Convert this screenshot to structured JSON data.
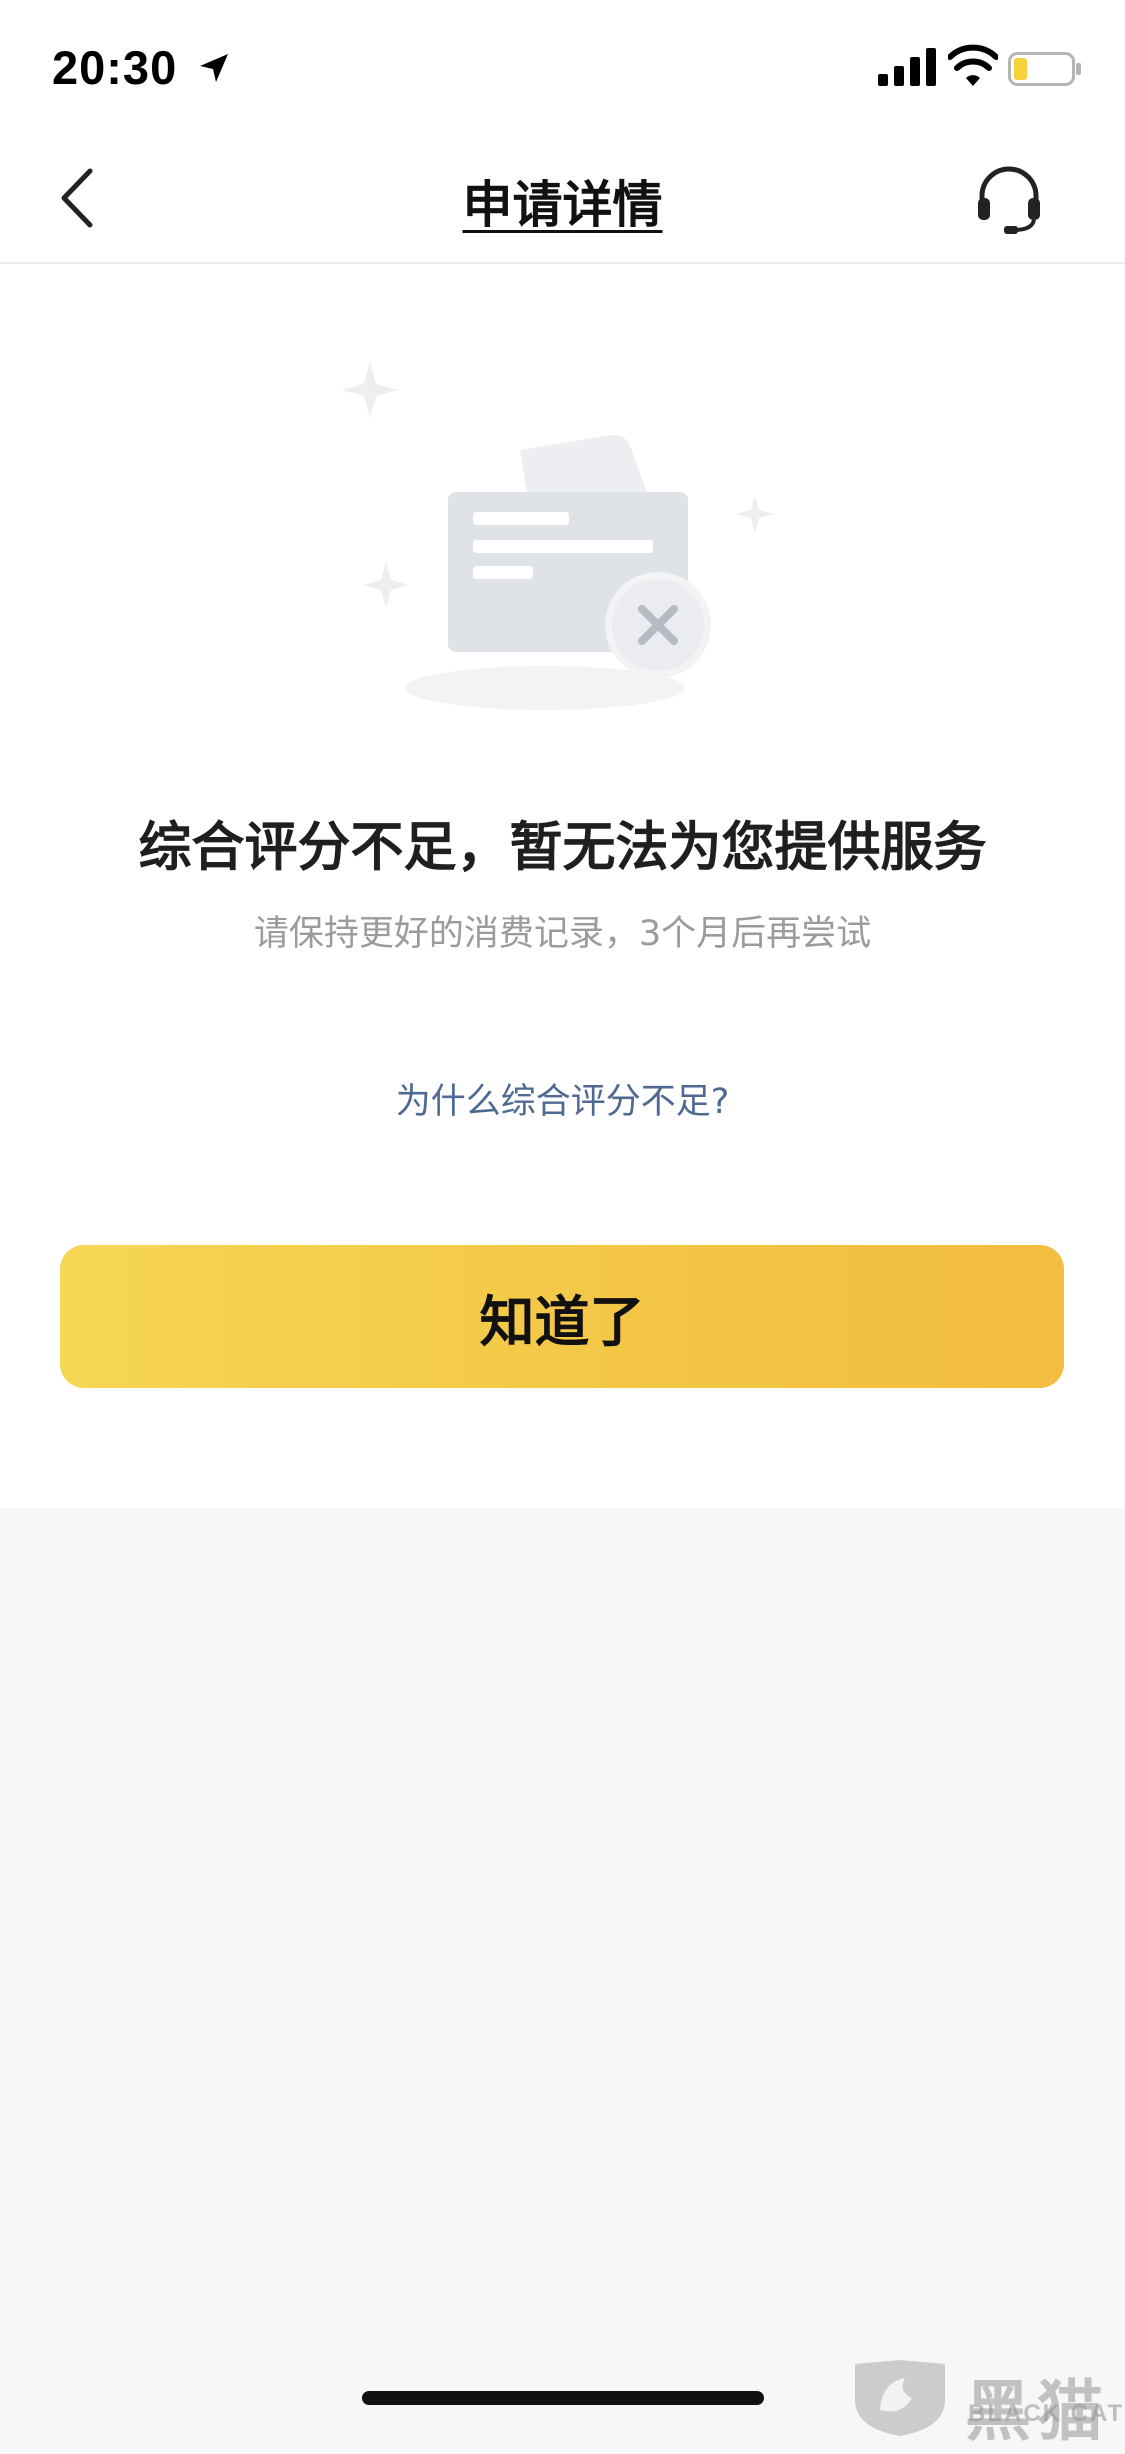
{
  "status_bar": {
    "time": "20:30",
    "icons": [
      "location-arrow-icon",
      "signal-icon",
      "wifi-icon",
      "battery-icon"
    ],
    "battery_color": "#f5d23c"
  },
  "nav": {
    "title": "申请详情",
    "back_icon": "chevron-left-icon",
    "service_icon": "headset-icon"
  },
  "result": {
    "illustration_icon": "rejected-card-icon",
    "title": "综合评分不足，暂无法为您提供服务",
    "subtitle": "请保持更好的消费记录，3个月后再尝试",
    "why_link": "为什么综合评分不足?"
  },
  "action": {
    "confirm_label": "知道了",
    "accent_color": "#f4c84a"
  },
  "watermark": {
    "text_cn": "黑猫",
    "text_en": "BLACK CAT",
    "icon": "black-cat-shield-logo"
  }
}
